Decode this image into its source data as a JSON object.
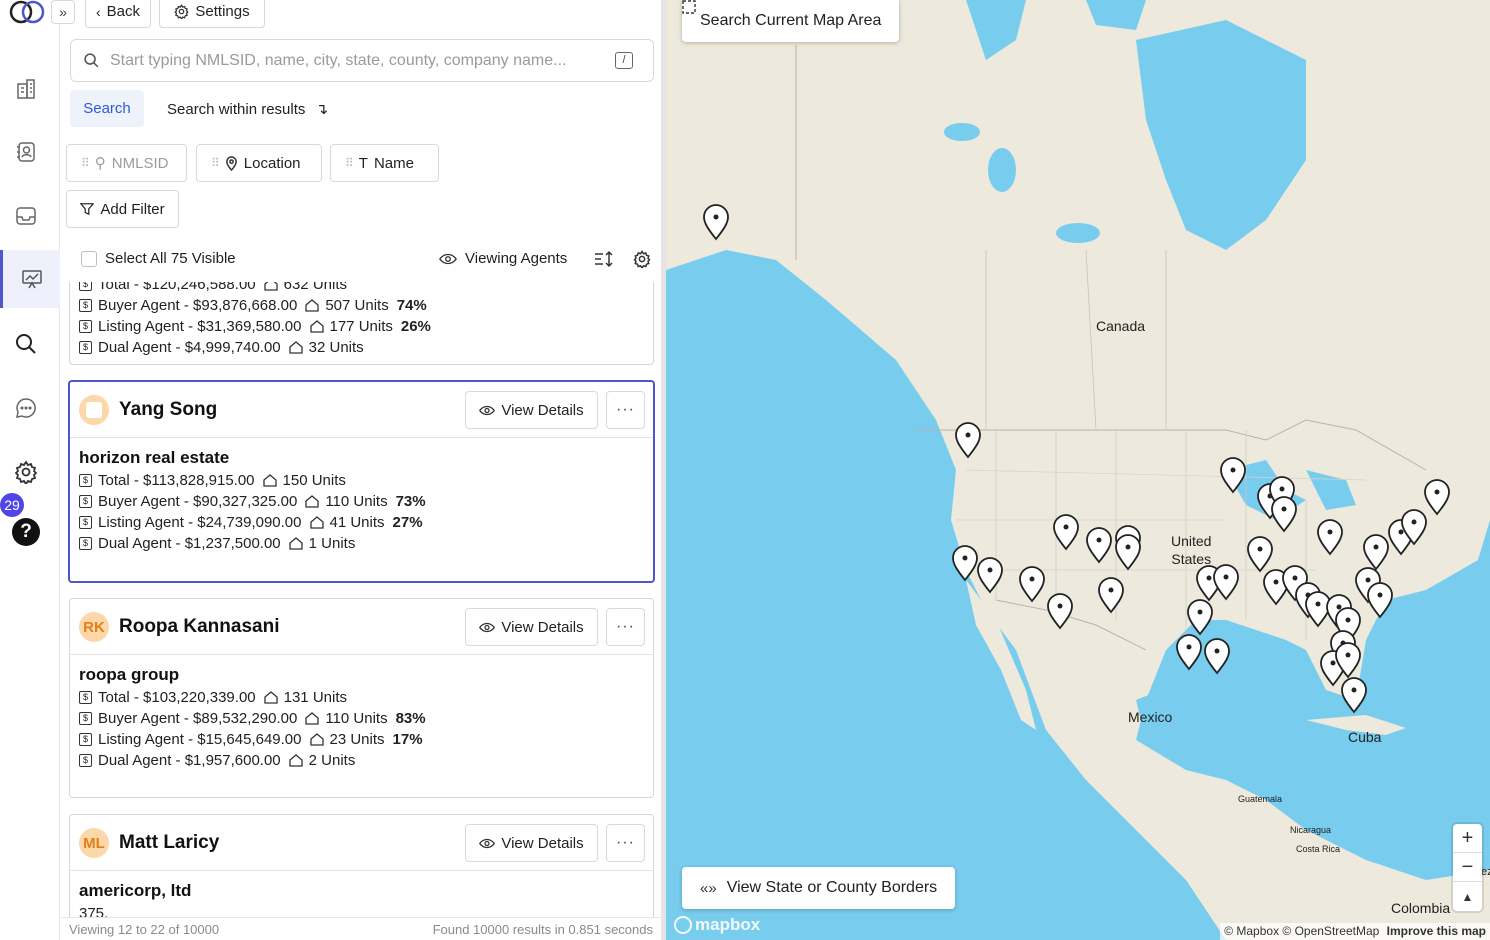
{
  "topbar": {
    "back_label": "Back",
    "settings_label": "Settings"
  },
  "search": {
    "placeholder": "Start typing NMLSID, name, city, state, county, company name...",
    "shortcut": "/",
    "search_label": "Search",
    "within_label": "Search within results"
  },
  "filters": {
    "chips": [
      "NMLSID",
      "Location",
      "Name"
    ],
    "add_filter_label": "Add Filter"
  },
  "list_header": {
    "select_all_label": "Select All 75 Visible",
    "viewing_label": "Viewing Agents"
  },
  "rail": {
    "badge_count": "29",
    "help_label": "?"
  },
  "cards": [
    {
      "partial": true,
      "lines": [
        {
          "label": "Total - $120,246,588.00",
          "units": "632 Units",
          "pct": ""
        },
        {
          "label": "Buyer Agent - $93,876,668.00",
          "units": "507 Units",
          "pct": "74%"
        },
        {
          "label": "Listing Agent - $31,369,580.00",
          "units": "177 Units",
          "pct": "26%"
        },
        {
          "label": "Dual Agent - $4,999,740.00",
          "units": "32 Units",
          "pct": ""
        }
      ]
    },
    {
      "name": "Yang Song",
      "initials": "",
      "company": "horizon real estate",
      "view_details_label": "View Details",
      "more_label": "···",
      "lines": [
        {
          "label": "Total - $113,828,915.00",
          "units": "150 Units",
          "pct": ""
        },
        {
          "label": "Buyer Agent - $90,327,325.00",
          "units": "110 Units",
          "pct": "73%"
        },
        {
          "label": "Listing Agent - $24,739,090.00",
          "units": "41 Units",
          "pct": "27%"
        },
        {
          "label": "Dual Agent - $1,237,500.00",
          "units": "1 Units",
          "pct": ""
        }
      ]
    },
    {
      "name": "Roopa Kannasani",
      "initials": "RK",
      "company": "roopa group",
      "view_details_label": "View Details",
      "more_label": "···",
      "lines": [
        {
          "label": "Total - $103,220,339.00",
          "units": "131 Units",
          "pct": ""
        },
        {
          "label": "Buyer Agent - $89,532,290.00",
          "units": "110 Units",
          "pct": "83%"
        },
        {
          "label": "Listing Agent - $15,645,649.00",
          "units": "23 Units",
          "pct": "17%"
        },
        {
          "label": "Dual Agent - $1,957,600.00",
          "units": "2 Units",
          "pct": ""
        }
      ]
    },
    {
      "name": "Matt Laricy",
      "initials": "ML",
      "company": "americorp, ltd",
      "view_details_label": "View Details",
      "more_label": "···",
      "address": "375,"
    }
  ],
  "footer": {
    "viewing": "Viewing 12 to 22 of 10000",
    "found": "Found 10000 results in 0.851 seconds"
  },
  "map": {
    "search_area_label": "Search Current Map Area",
    "borders_label": "View State or County Borders",
    "labels": {
      "canada": "Canada",
      "us_line1": "United",
      "us_line2": "States",
      "mexico": "Mexico",
      "cuba": "Cuba",
      "guatemala": "Guatemala",
      "nicaragua": "Nicaragua",
      "costa_rica": "Costa Rica",
      "colombia": "Colombia",
      "venezuela_partial": "ez"
    },
    "zoom_in": "+",
    "zoom_out": "−",
    "compass": "▲",
    "logo": "mapbox",
    "attribution": "© Mapbox © OpenStreetMap",
    "improve": "Improve this map",
    "colors": {
      "water": "#78cdef",
      "land": "#ede9dc",
      "border": "#b9b4a8"
    }
  }
}
